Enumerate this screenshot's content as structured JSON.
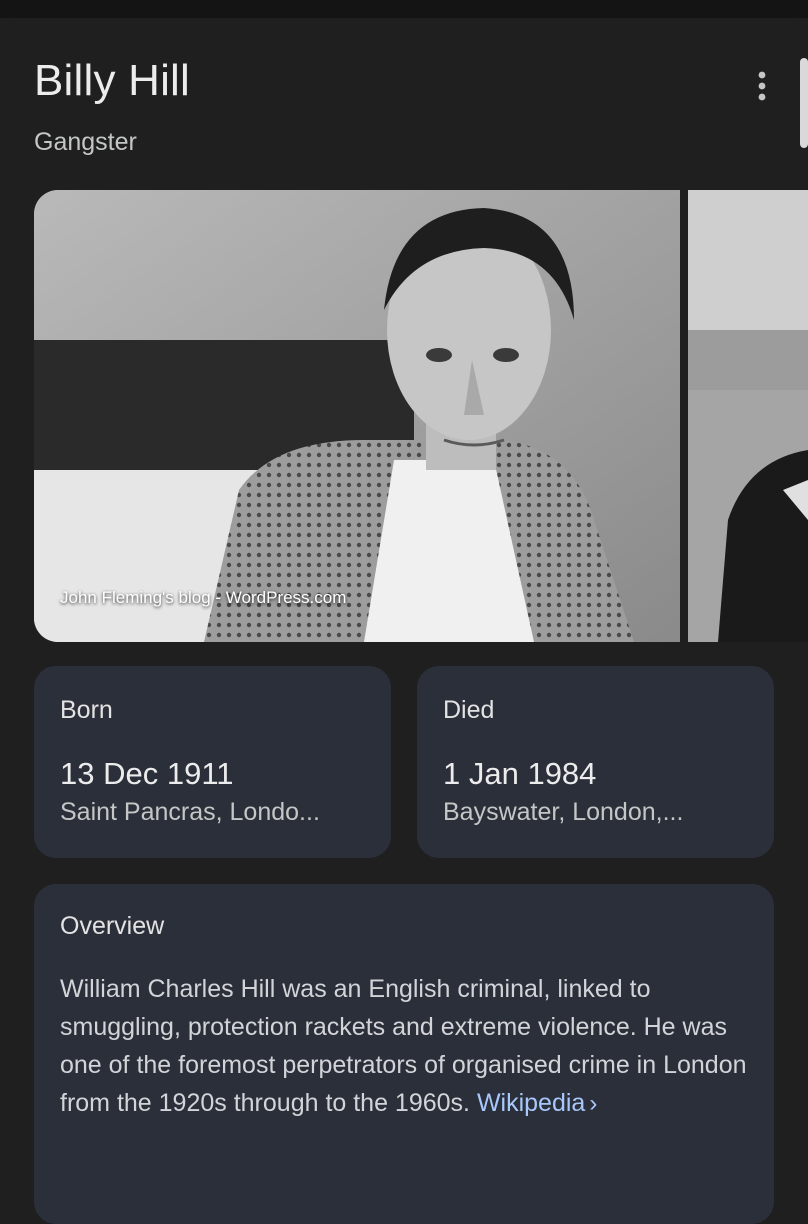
{
  "entity": {
    "name": "Billy Hill",
    "description": "Gangster"
  },
  "menu": {
    "icon": "more-vert-icon"
  },
  "gallery": {
    "main_photo_credit": "John Fleming's blog - WordPress.com",
    "photo_tone": "black-and-white"
  },
  "facts": {
    "born": {
      "label": "Born",
      "date": "13 Dec 1911",
      "place": "Saint Pancras, Londo..."
    },
    "died": {
      "label": "Died",
      "date": "1 Jan 1984",
      "place": "Bayswater, London,..."
    }
  },
  "overview": {
    "label": "Overview",
    "text": "William Charles Hill was an English criminal, linked to smuggling, protection rackets and extreme violence. He was one of the foremost perpetrators of organised crime in London from the 1920s through to the 1960s.",
    "source_link": "Wikipedia",
    "source_chevron": "›"
  },
  "colors": {
    "background": "#1f1f1f",
    "card": "#2b2f3a",
    "link": "#a8c7fa"
  }
}
